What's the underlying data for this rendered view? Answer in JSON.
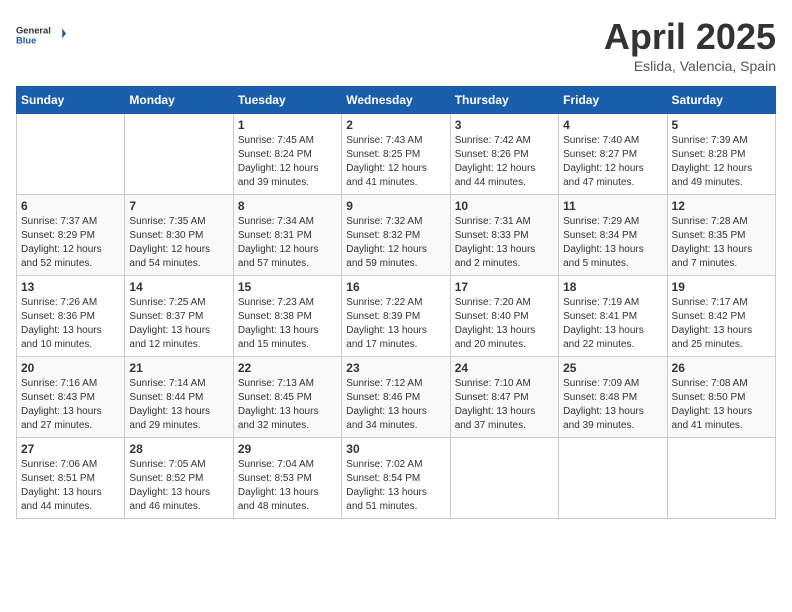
{
  "header": {
    "logo_general": "General",
    "logo_blue": "Blue",
    "title": "April 2025",
    "subtitle": "Eslida, Valencia, Spain"
  },
  "days_of_week": [
    "Sunday",
    "Monday",
    "Tuesday",
    "Wednesday",
    "Thursday",
    "Friday",
    "Saturday"
  ],
  "weeks": [
    [
      {
        "day": "",
        "info": ""
      },
      {
        "day": "",
        "info": ""
      },
      {
        "day": "1",
        "info": "Sunrise: 7:45 AM\nSunset: 8:24 PM\nDaylight: 12 hours and 39 minutes."
      },
      {
        "day": "2",
        "info": "Sunrise: 7:43 AM\nSunset: 8:25 PM\nDaylight: 12 hours and 41 minutes."
      },
      {
        "day": "3",
        "info": "Sunrise: 7:42 AM\nSunset: 8:26 PM\nDaylight: 12 hours and 44 minutes."
      },
      {
        "day": "4",
        "info": "Sunrise: 7:40 AM\nSunset: 8:27 PM\nDaylight: 12 hours and 47 minutes."
      },
      {
        "day": "5",
        "info": "Sunrise: 7:39 AM\nSunset: 8:28 PM\nDaylight: 12 hours and 49 minutes."
      }
    ],
    [
      {
        "day": "6",
        "info": "Sunrise: 7:37 AM\nSunset: 8:29 PM\nDaylight: 12 hours and 52 minutes."
      },
      {
        "day": "7",
        "info": "Sunrise: 7:35 AM\nSunset: 8:30 PM\nDaylight: 12 hours and 54 minutes."
      },
      {
        "day": "8",
        "info": "Sunrise: 7:34 AM\nSunset: 8:31 PM\nDaylight: 12 hours and 57 minutes."
      },
      {
        "day": "9",
        "info": "Sunrise: 7:32 AM\nSunset: 8:32 PM\nDaylight: 12 hours and 59 minutes."
      },
      {
        "day": "10",
        "info": "Sunrise: 7:31 AM\nSunset: 8:33 PM\nDaylight: 13 hours and 2 minutes."
      },
      {
        "day": "11",
        "info": "Sunrise: 7:29 AM\nSunset: 8:34 PM\nDaylight: 13 hours and 5 minutes."
      },
      {
        "day": "12",
        "info": "Sunrise: 7:28 AM\nSunset: 8:35 PM\nDaylight: 13 hours and 7 minutes."
      }
    ],
    [
      {
        "day": "13",
        "info": "Sunrise: 7:26 AM\nSunset: 8:36 PM\nDaylight: 13 hours and 10 minutes."
      },
      {
        "day": "14",
        "info": "Sunrise: 7:25 AM\nSunset: 8:37 PM\nDaylight: 13 hours and 12 minutes."
      },
      {
        "day": "15",
        "info": "Sunrise: 7:23 AM\nSunset: 8:38 PM\nDaylight: 13 hours and 15 minutes."
      },
      {
        "day": "16",
        "info": "Sunrise: 7:22 AM\nSunset: 8:39 PM\nDaylight: 13 hours and 17 minutes."
      },
      {
        "day": "17",
        "info": "Sunrise: 7:20 AM\nSunset: 8:40 PM\nDaylight: 13 hours and 20 minutes."
      },
      {
        "day": "18",
        "info": "Sunrise: 7:19 AM\nSunset: 8:41 PM\nDaylight: 13 hours and 22 minutes."
      },
      {
        "day": "19",
        "info": "Sunrise: 7:17 AM\nSunset: 8:42 PM\nDaylight: 13 hours and 25 minutes."
      }
    ],
    [
      {
        "day": "20",
        "info": "Sunrise: 7:16 AM\nSunset: 8:43 PM\nDaylight: 13 hours and 27 minutes."
      },
      {
        "day": "21",
        "info": "Sunrise: 7:14 AM\nSunset: 8:44 PM\nDaylight: 13 hours and 29 minutes."
      },
      {
        "day": "22",
        "info": "Sunrise: 7:13 AM\nSunset: 8:45 PM\nDaylight: 13 hours and 32 minutes."
      },
      {
        "day": "23",
        "info": "Sunrise: 7:12 AM\nSunset: 8:46 PM\nDaylight: 13 hours and 34 minutes."
      },
      {
        "day": "24",
        "info": "Sunrise: 7:10 AM\nSunset: 8:47 PM\nDaylight: 13 hours and 37 minutes."
      },
      {
        "day": "25",
        "info": "Sunrise: 7:09 AM\nSunset: 8:48 PM\nDaylight: 13 hours and 39 minutes."
      },
      {
        "day": "26",
        "info": "Sunrise: 7:08 AM\nSunset: 8:50 PM\nDaylight: 13 hours and 41 minutes."
      }
    ],
    [
      {
        "day": "27",
        "info": "Sunrise: 7:06 AM\nSunset: 8:51 PM\nDaylight: 13 hours and 44 minutes."
      },
      {
        "day": "28",
        "info": "Sunrise: 7:05 AM\nSunset: 8:52 PM\nDaylight: 13 hours and 46 minutes."
      },
      {
        "day": "29",
        "info": "Sunrise: 7:04 AM\nSunset: 8:53 PM\nDaylight: 13 hours and 48 minutes."
      },
      {
        "day": "30",
        "info": "Sunrise: 7:02 AM\nSunset: 8:54 PM\nDaylight: 13 hours and 51 minutes."
      },
      {
        "day": "",
        "info": ""
      },
      {
        "day": "",
        "info": ""
      },
      {
        "day": "",
        "info": ""
      }
    ]
  ]
}
